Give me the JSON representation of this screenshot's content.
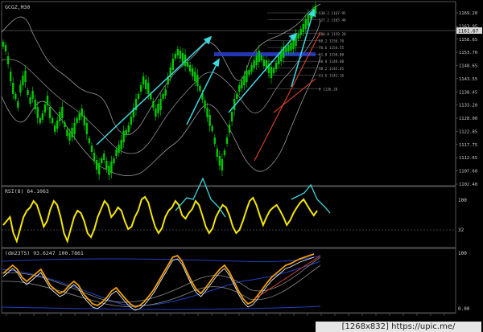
{
  "main_panel": {
    "symbol_title": "GCGZ,M30",
    "price_labels": [
      "1169.20",
      "1163.95",
      "1158.65",
      "1153.70",
      "1148.65",
      "1143.55",
      "1138.45",
      "1133.20",
      "1128.00",
      "1122.85",
      "1117.75",
      "1112.65",
      "1107.60",
      "1102.40"
    ],
    "current_price": "1161.67",
    "fib_levels": [
      {
        "label": "138.2  1167.95",
        "row": 0
      },
      {
        "label": "127.2  1165.40",
        "row": 1
      },
      {
        "label": "100.0  1159.28",
        "row": 3
      },
      {
        "label": "88.2  1156.70",
        "row": 4
      },
      {
        "label": "78.6  1154.55",
        "row": 5
      },
      {
        "label": "61.8  1150.80",
        "row": 6
      },
      {
        "label": "50.0  1148.08",
        "row": 7
      },
      {
        "label": "38.2  1145.45",
        "row": 8
      },
      {
        "label": "23.6  1142.16",
        "row": 9
      },
      {
        "label": "0  1136.28",
        "row": 11
      }
    ]
  },
  "rsi_panel": {
    "title": "RSI(8) 64.1063",
    "levels": [
      "100",
      "32"
    ]
  },
  "stoch_panel": {
    "title": "(dm23TS) 93.6247 100.7861",
    "levels": [
      "100",
      "0.00"
    ]
  },
  "watermark": "[1268x832] https://upic.me/",
  "colors": {
    "background": "#000000",
    "candle": "#00c800",
    "band": "#9a9a9a",
    "trend": "#3fd8e0",
    "support": "#e0442a",
    "rsi": "#f5e600",
    "stoch_main": "#f5a000",
    "stoch_signal": "#f0f0f0",
    "stoch_blue": "#2040c0"
  }
}
